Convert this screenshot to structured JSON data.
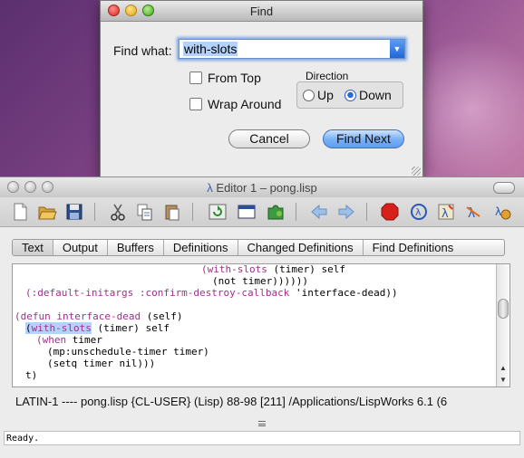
{
  "find_dialog": {
    "title": "Find",
    "find_what_label": "Find what:",
    "find_what_value": "with-slots",
    "from_top_label": "From Top",
    "wrap_around_label": "Wrap Around",
    "direction_label": "Direction",
    "up_label": "Up",
    "down_label": "Down",
    "direction_selected": "Down",
    "cancel_label": "Cancel",
    "find_next_label": "Find Next"
  },
  "editor": {
    "title": "Editor 1 – pong.lisp",
    "tabs": [
      {
        "label": "Text",
        "active": true
      },
      {
        "label": "Output"
      },
      {
        "label": "Buffers"
      },
      {
        "label": "Definitions"
      },
      {
        "label": "Changed Definitions"
      },
      {
        "label": "Find Definitions"
      }
    ],
    "code": {
      "l1_kw": "(with-slots",
      "l1_rest": " (timer) self",
      "l2": "(not timer))))))",
      "l3_kw": "(:default-initargs :confirm-destroy-callback",
      "l3_rest": " 'interface-dead))",
      "l5_kw": "(defun interface-dead",
      "l5_rest": " (self)",
      "l6_paren": "(",
      "l6_sel": "with-slots",
      "l6_rest": " (timer) self",
      "l7_kw": "(when",
      "l7_rest": " timer",
      "l8": "(mp:unschedule-timer timer)",
      "l9": "(setq timer nil)))",
      "l10": "t)"
    },
    "modeline": "LATIN-1 ---- pong.lisp   {CL-USER} (Lisp) 88-98 [211] /Applications/LispWorks 6.1 (6",
    "echo": "Ready."
  },
  "colors": {
    "keyword": "#a0308a",
    "selection": "#b3d3fd",
    "accent": "#5f9cf0"
  }
}
